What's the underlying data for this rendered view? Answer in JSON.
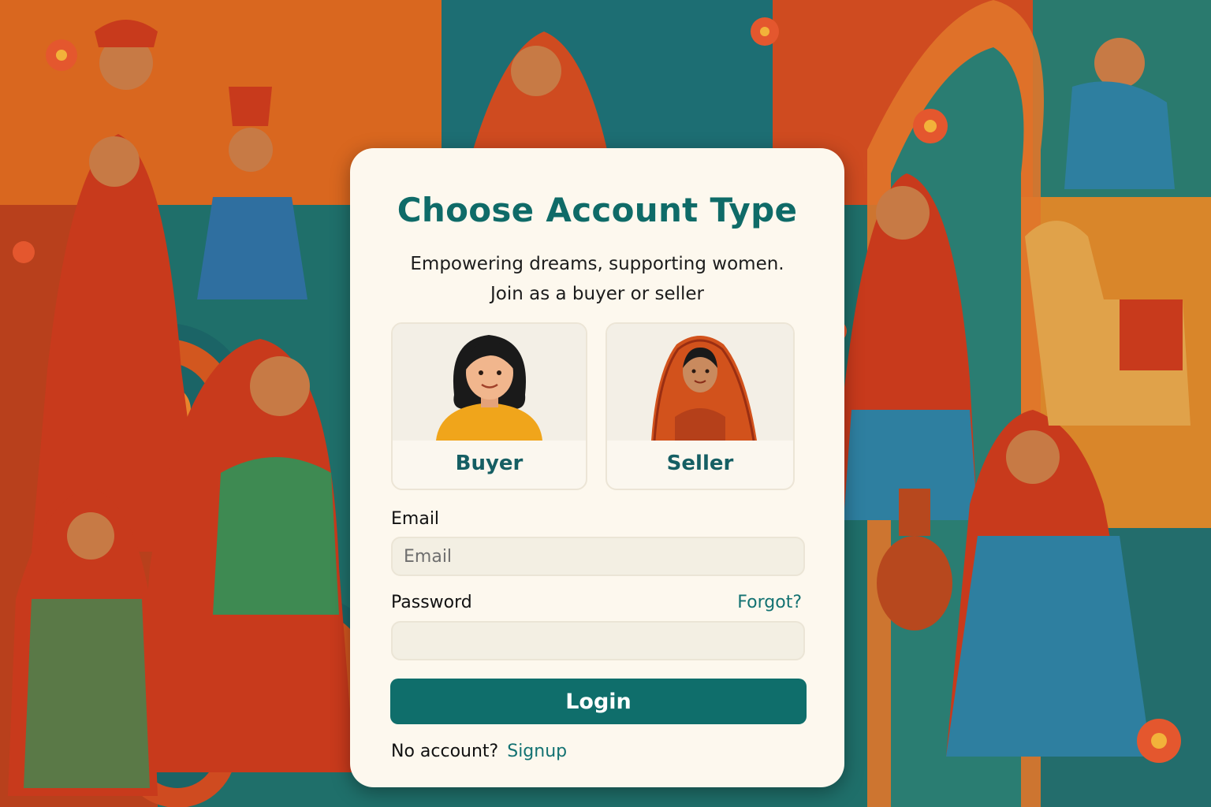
{
  "login_card": {
    "title": "Choose Account Type",
    "subtitle_line1": "Empowering dreams, supporting women.",
    "subtitle_line2": "Join as a buyer or seller",
    "account_types": [
      {
        "label": "Buyer",
        "icon": "woman-avatar-icon"
      },
      {
        "label": "Seller",
        "icon": "woman-in-saree-avatar-icon"
      }
    ],
    "email": {
      "label": "Email",
      "placeholder": "Email",
      "value": ""
    },
    "password": {
      "label": "Password",
      "placeholder": "",
      "value": "",
      "forgot_link": "Forgot?"
    },
    "login_button": "Login",
    "footer": {
      "prompt": "No account?",
      "signup_link": "Signup"
    }
  },
  "colors": {
    "accent": "#0f6e6b",
    "card_background": "#fdf8ee",
    "art_orange": "#d9531e",
    "art_teal": "#1f6f6a"
  }
}
